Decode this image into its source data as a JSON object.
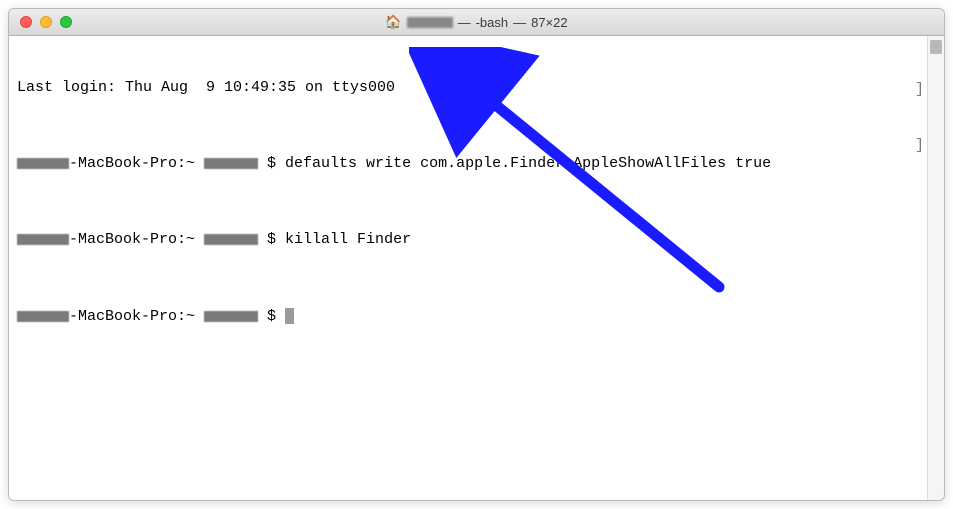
{
  "titlebar": {
    "icon_name": "home-icon",
    "username_redacted": "███",
    "sep1": " — ",
    "shell": "-bash",
    "sep2": " — ",
    "dimensions": "87×22"
  },
  "terminal": {
    "last_login": "Last login: Thu Aug  9 10:49:35 on ttys000",
    "prompt_host": "-MacBook-Pro:~ ",
    "prompt_suffix": " $ ",
    "cmd1": "defaults write com.apple.Finder AppleShowAllFiles true",
    "cmd2": "killall Finder",
    "cmd3": ""
  },
  "annotation": {
    "arrow_color": "#1b1bff"
  }
}
